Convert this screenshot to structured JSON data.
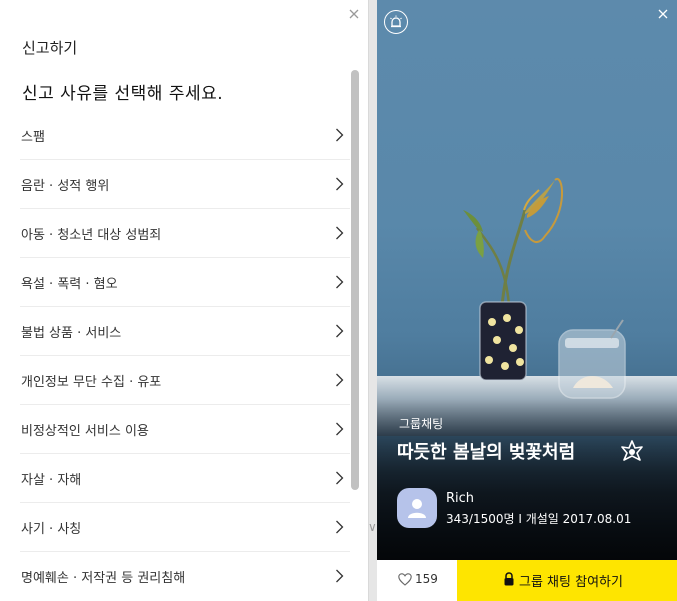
{
  "report_dialog": {
    "title": "신고하기",
    "subtitle": "신고 사유를 선택해 주세요.",
    "reasons": [
      {
        "label": "스팸"
      },
      {
        "label": "음란 · 성적 행위"
      },
      {
        "label": "아동 · 청소년 대상 성범죄"
      },
      {
        "label": "욕설 · 폭력 · 혐오"
      },
      {
        "label": "불법 상품 · 서비스"
      },
      {
        "label": "개인정보 무단 수집 · 유포"
      },
      {
        "label": "비정상적인 서비스 이용"
      },
      {
        "label": "자살 · 자해"
      },
      {
        "label": "사기 · 사칭"
      },
      {
        "label": "명예훼손 · 저작권 등 권리침해"
      }
    ]
  },
  "chat_card": {
    "room_type": "그룹채팅",
    "room_title": "따듯한 봄날의 벚꽃처럼",
    "owner": {
      "name": "Rich",
      "meta": "343/1500명 I 개설일 2017.08.01"
    },
    "like_count": "159",
    "join_label": "그룹 채팅 참여하기"
  },
  "colors": {
    "join_button": "#fee500",
    "avatar_bg": "#b6c3ea"
  },
  "icons": {
    "report_alarm": "alarm-icon",
    "close": "close-icon",
    "reason_chevron": "chevron-right-icon",
    "like": "heart-icon",
    "join": "lock-icon",
    "avatar": "person-icon"
  }
}
